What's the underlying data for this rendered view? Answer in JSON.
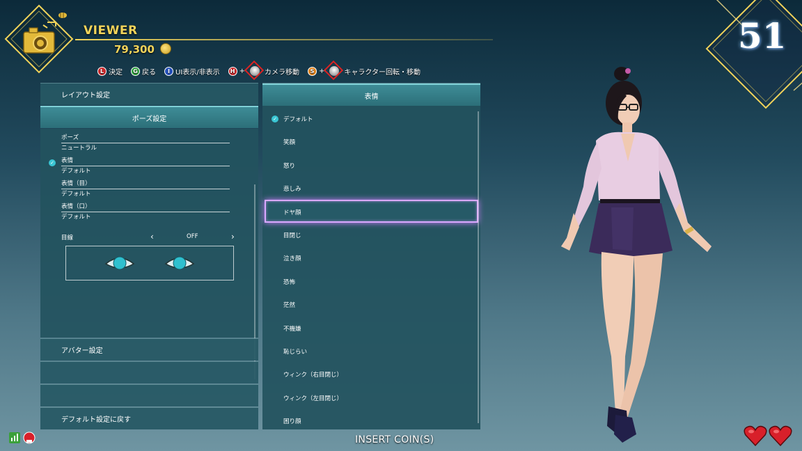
{
  "header": {
    "title": "VIEWER",
    "coins": "79,300"
  },
  "controls": [
    {
      "key": "L",
      "color": "#c8282b",
      "label": "決定"
    },
    {
      "key": "G",
      "color": "#2aa13a",
      "label": "戻る"
    },
    {
      "key": "I",
      "color": "#2450b8",
      "label": "UI表示/非表示"
    },
    {
      "key": "H",
      "color": "#c8282b",
      "label": "+",
      "stick": true,
      "after": "カメラ移動"
    },
    {
      "key": "S",
      "color": "#e0821a",
      "label": "+",
      "stick": true,
      "after": "キャラクター回転・移動"
    }
  ],
  "left_panel": {
    "layout_settings": "レイアウト設定",
    "pose_settings": "ポーズ設定",
    "items": [
      {
        "label": "ポーズ",
        "value": "ニュートラル",
        "checked": false
      },
      {
        "label": "表情",
        "value": "デフォルト",
        "checked": true
      },
      {
        "label": "表情（目）",
        "value": "デフォルト",
        "checked": false
      },
      {
        "label": "表情（口）",
        "value": "デフォルト",
        "checked": false
      }
    ],
    "gaze_label": "目線",
    "gaze_value": "OFF",
    "avatar_settings": "アバター設定",
    "reset_default": "デフォルト設定に戻す"
  },
  "expression_panel": {
    "title": "表情",
    "items": [
      "デフォルト",
      "笑顔",
      "怒り",
      "悲しみ",
      "ドヤ顔",
      "目閉じ",
      "泣き顔",
      "恐怖",
      "茫然",
      "不機嫌",
      "恥じらい",
      "ウィンク（右目閉じ）",
      "ウィンク（左目閉じ）",
      "困り顔"
    ],
    "checked_index": 0,
    "selected_index": 4
  },
  "timer": "51",
  "insert_coin": "INSERT COIN(S)",
  "colors": {
    "accent": "#3ac6d4",
    "gold": "#f1d35a",
    "highlight": "#d9a8ff"
  }
}
